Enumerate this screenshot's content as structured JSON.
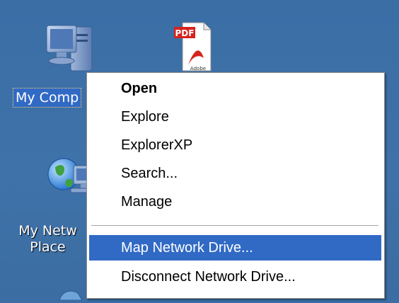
{
  "desktop": {
    "background": "#3a6ea5",
    "icons": [
      {
        "name": "my-computer",
        "label": "My Comp",
        "selected": true
      },
      {
        "name": "adobe-pdf",
        "badge": "PDF",
        "caption": "Adobe"
      },
      {
        "name": "my-network-places",
        "label_line1": "My Netw",
        "label_line2": "Place"
      }
    ]
  },
  "context_menu": {
    "items": [
      {
        "label": "Open",
        "default": true
      },
      {
        "label": "Explore"
      },
      {
        "label": "ExplorerXP"
      },
      {
        "label": "Search..."
      },
      {
        "label": "Manage"
      },
      {
        "label": "Map Network Drive...",
        "highlighted": true
      },
      {
        "label": "Disconnect Network Drive..."
      }
    ],
    "highlight_color": "#316ac5"
  }
}
